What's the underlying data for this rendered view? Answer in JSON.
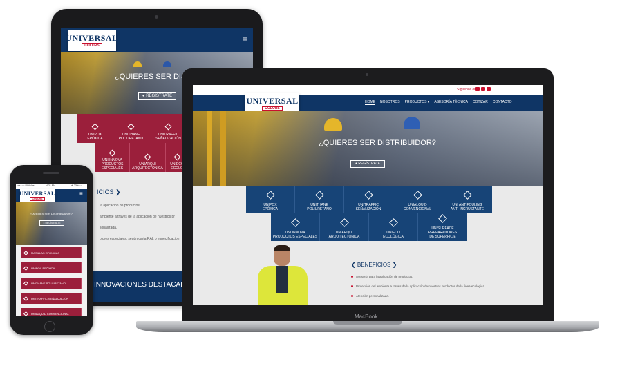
{
  "site": {
    "logo_main": "UNIVERSAL",
    "logo_sub": "COLORS",
    "social_text": "Síguenos en:",
    "nav": [
      "HOME",
      "NOSOTROS",
      "PRODUCTOS ▾",
      "ASESORÍA TÉCNICA",
      "COTIZAR",
      "CONTACTO"
    ],
    "hero_title": "¿QUIERES SER DISTRIBUIDOR?",
    "register_label": "● REGÍSTRATE",
    "products_row1": [
      {
        "line1": "UNIPOX",
        "line2": "EPÓXICA"
      },
      {
        "line1": "UNITHANE",
        "line2": "POLIURETANO"
      },
      {
        "line1": "UNITRAFFIC",
        "line2": "SEÑALIZACIÓN"
      },
      {
        "line1": "UNIALQUID",
        "line2": "CONVENCIONAL"
      },
      {
        "line1": "UNI ANTIFOULING",
        "line2": "ANTI-INCRUSTANTE"
      }
    ],
    "products_row2": [
      {
        "line1": "UNI INNOVA",
        "line2": "PRODUCTOS ESPECIALES"
      },
      {
        "line1": "UNIARQUI",
        "line2": "ARQUITECTÓNICA"
      },
      {
        "line1": "UNIECO",
        "line2": "ECOLÓGICA"
      },
      {
        "line1": "UNISURFACE PREPARADORES",
        "line2": "DE SUPERFICIE"
      }
    ],
    "benefits_title": "❮ BENEFICIOS ❯",
    "benefits": [
      "Asesoría para la aplicación de productos.",
      "Protección del ambiente a través de la aplicación de nuestros productos de la línea ecológica.",
      "Atención personalizada."
    ]
  },
  "tablet": {
    "hero_title": "¿QUIERES SER DISTRIBU",
    "register_label": "● REGÍSTRATE",
    "tiles_row1": [
      {
        "line1": "UNIPOX",
        "line2": "EPÓXICA"
      },
      {
        "line1": "UNITHANE",
        "line2": "POLIURETANO"
      },
      {
        "line1": "UNITRAFFIC",
        "line2": "SEÑALIZACIÓN"
      }
    ],
    "tiles_row2": [
      {
        "line1": "UNI INNOVA",
        "line2": "PRODUCTOS ESPECIALES"
      },
      {
        "line1": "UNIARQUI",
        "line2": "ARQUITECTÓNICA"
      },
      {
        "line1": "UNIECO",
        "line2": "ECOLÓ"
      }
    ],
    "benefits_title": "ICIOS ❯",
    "benefit_lines": [
      "la aplicación de productos.",
      "ambiente a través de la aplicación de nuestros pr",
      "sonalizada.",
      "olores especiales, según carta RAL o especificacion"
    ],
    "banner": "INNOVACIONES DESTACADAS",
    "menu_icon": "≡"
  },
  "laptop": {
    "brand_label": "MacBook"
  },
  "phone": {
    "status_left": "●●●○○ PLAN ᯤ",
    "status_time": "4:21 PM",
    "status_right": "⊕ 23% ▭",
    "hero_title": "¿QUIERES SER DISTRIBUIDOR?",
    "register_label": "● REGÍSTRATE",
    "menu_icon": "≡",
    "list": [
      "MASILLAS EPÓXICAS",
      "UNIPOX EPÓXICA",
      "UNITHANE POLIURETANO",
      "UNITRAFFIC SEÑALIZACIÓN",
      "UNIALQUID CONVENCIONAL"
    ]
  },
  "colors": {
    "navy": "#0f3565",
    "tile_blue": "#174477",
    "tile_red": "#9b1f3b",
    "accent_red": "#c8102e"
  }
}
